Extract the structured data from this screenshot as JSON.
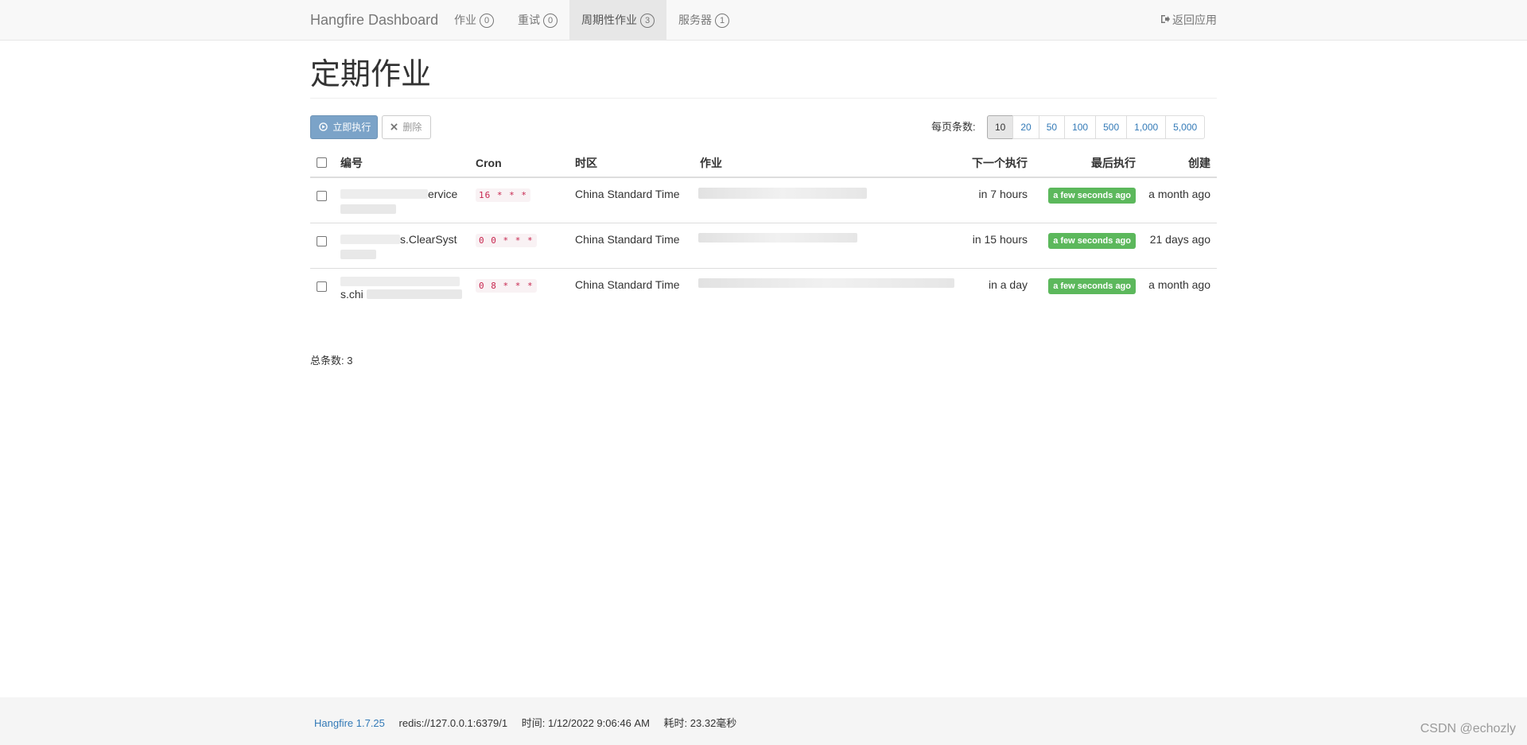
{
  "navbar": {
    "brand": "Hangfire Dashboard",
    "items": [
      {
        "label": "作业",
        "badge": "0",
        "active": false
      },
      {
        "label": "重试",
        "badge": "0",
        "active": false
      },
      {
        "label": "周期性作业",
        "badge": "3",
        "active": true
      },
      {
        "label": "服务器",
        "badge": "1",
        "active": false
      }
    ],
    "back_label": "返回应用"
  },
  "page": {
    "title": "定期作业"
  },
  "toolbar": {
    "trigger_label": "立即执行",
    "delete_label": "删除",
    "per_page_label": "每页条数:",
    "per_page_options": [
      "10",
      "20",
      "50",
      "100",
      "500",
      "1,000",
      "5,000"
    ],
    "per_page_selected": "10"
  },
  "table": {
    "headers": {
      "id": "编号",
      "cron": "Cron",
      "timezone": "时区",
      "job": "作业",
      "next": "下一个执行",
      "last": "最后执行",
      "created": "创建"
    },
    "rows": [
      {
        "id": "ervice",
        "cron": "16 * * *",
        "timezone": "China Standard Time",
        "next": "in 7 hours",
        "last": "a few seconds ago",
        "created": "a month ago"
      },
      {
        "id": "s.ClearSyst",
        "cron": "0 0 * * *",
        "timezone": "China Standard Time",
        "next": "in 15 hours",
        "last": "a few seconds ago",
        "created": "21 days ago"
      },
      {
        "id": "s.chi",
        "cron": "0 8 * * *",
        "timezone": "China Standard Time",
        "next": "in a day",
        "last": "a few seconds ago",
        "created": "a month ago"
      }
    ],
    "total_label": "总条数: 3"
  },
  "footer": {
    "version": "Hangfire 1.7.25",
    "storage": "redis://127.0.0.1:6379/1",
    "time": "时间: 1/12/2022 9:06:46 AM",
    "elapsed": "耗时: 23.32毫秒"
  },
  "watermark": "CSDN @echozly",
  "colors": {
    "navbar_bg": "#f8f8f8",
    "primary_button": "#7ba3c8",
    "success_label": "#5cb85c",
    "cron_text": "#c7254e",
    "link": "#337ab7"
  },
  "icons": {
    "back": "sign-out-icon",
    "trigger": "play-circle-icon",
    "delete": "times-icon"
  }
}
